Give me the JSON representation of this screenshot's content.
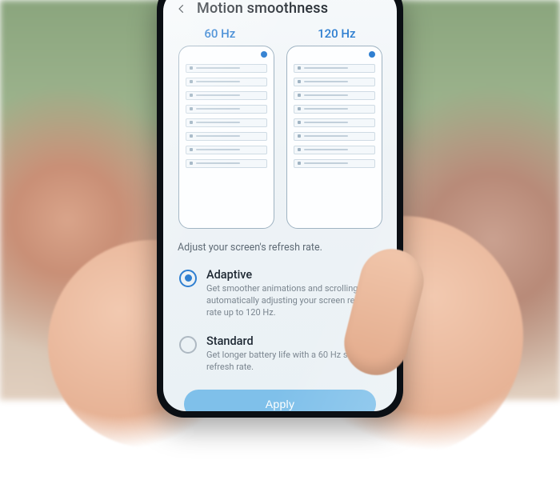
{
  "header": {
    "title": "Motion smoothness"
  },
  "hz": {
    "left": "60 Hz",
    "right": "120 Hz"
  },
  "section": {
    "desc": "Adjust your screen's refresh rate."
  },
  "options": {
    "adaptive": {
      "name": "Adaptive",
      "desc": "Get smoother animations and scrolling by automatically adjusting your screen refresh rate up to 120 Hz.",
      "selected": true
    },
    "standard": {
      "name": "Standard",
      "desc": "Get longer battery life with a 60 Hz screen refresh rate.",
      "selected": false
    }
  },
  "apply": {
    "label": "Apply"
  },
  "colors": {
    "accent": "#2f7fd1",
    "apply_bg": "#7fc0ea"
  }
}
